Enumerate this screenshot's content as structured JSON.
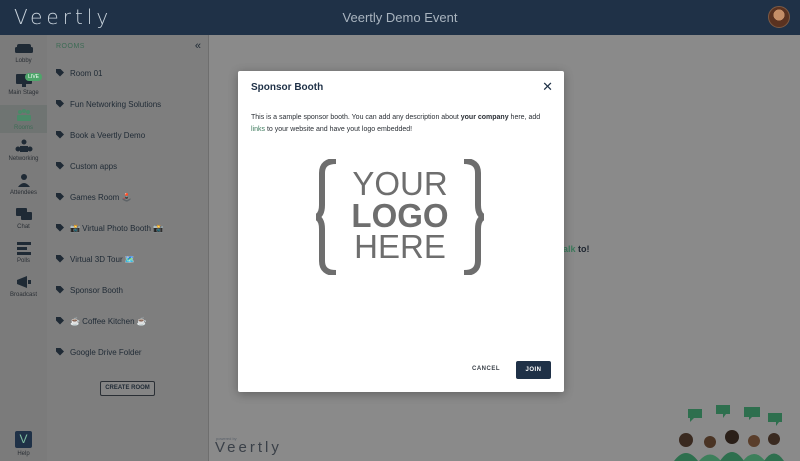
{
  "app": {
    "brand": "Veertly",
    "event_title": "Veertly Demo Event"
  },
  "rail": {
    "lobby": "Lobby",
    "main_stage": "Main Stage",
    "live": "LIVE",
    "rooms": "Rooms",
    "networking": "Networking",
    "attendees": "Attendees",
    "chat": "Chat",
    "polls": "Polls",
    "broadcast": "Broadcast",
    "help": "Help",
    "help_logo": "V"
  },
  "rooms_panel": {
    "heading": "ROOMS",
    "collapse": "«",
    "items": [
      "Room 01",
      "Fun Networking Solutions",
      "Book a Veertly Demo",
      "Custom apps",
      "Games Room 🕹️",
      "📸 Virtual Photo Booth 📸",
      "Virtual 3D Tour 🗺️",
      "Sponsor Booth",
      "☕ Coffee Kitchen ☕",
      "Google Drive Folder"
    ],
    "create_room": "CREATE ROOM"
  },
  "main": {
    "talk_link": "alk",
    "talk_suffix": " to!",
    "powered_by": "powered by",
    "powered_brand": "Veertly"
  },
  "modal": {
    "title": "Sponsor Booth",
    "close": "✕",
    "desc_part1": "This is a sample sponsor booth. You can add any description about ",
    "desc_bold": "your company",
    "desc_part2": " here, add ",
    "desc_link": "links",
    "desc_part3": " to your website and have yout logo embedded!",
    "logo_line1": "YOUR",
    "logo_line2": "LOGO",
    "logo_line3": "HERE",
    "cancel": "CANCEL",
    "join": "JOIN"
  },
  "colors": {
    "topbar": "#1f3147",
    "accent_green": "#3c7a5c",
    "button": "#1f3147"
  }
}
